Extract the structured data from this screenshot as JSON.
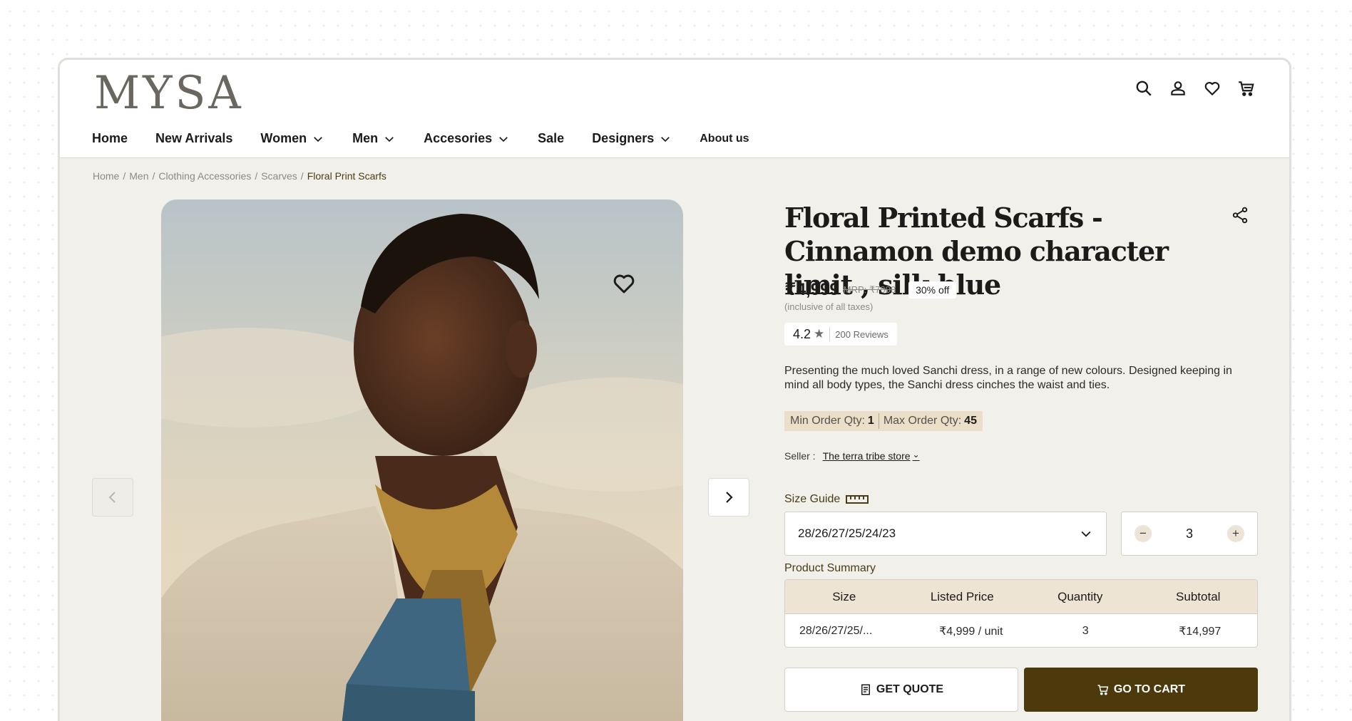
{
  "brand": {
    "logo_text": "MYSA"
  },
  "header_icons": [
    "search-icon",
    "user-icon",
    "heart-icon",
    "cart-icon"
  ],
  "nav": {
    "home": "Home",
    "new_arrivals": "New Arrivals",
    "women": "Women",
    "men": "Men",
    "accesories": "Accesories",
    "sale": "Sale",
    "designers": "Designers",
    "about": "About us"
  },
  "breadcrumb": {
    "home": "Home",
    "men": "Men",
    "clothing": "Clothing Accessories",
    "scarves": "Scarves",
    "current": "Floral Print Scarfs",
    "separator": "/"
  },
  "product": {
    "title": "Floral Printed Scarfs - Cinnamon demo character limit , silk blue",
    "price": "₹4,999",
    "mrp": "MRP: ₹7000",
    "discount": "30% off",
    "tax_note": "(inclusive of all taxes)",
    "rating": "4.2",
    "rating_star": "★",
    "reviews": "200 Reviews",
    "description": "Presenting the much loved Sanchi dress, in a range of new colours. Designed keeping in mind all body types, the Sanchi dress cinches the waist and ties.",
    "min_qty_label": "Min Order Qty:",
    "min_qty": "1",
    "max_qty_label": "Max Order Qty:",
    "max_qty": "45",
    "seller_label": "Seller :",
    "seller_name": "The terra tribe store"
  },
  "size": {
    "guide_label": "Size Guide",
    "selected": "28/26/27/25/24/23"
  },
  "quantity": {
    "value": "3",
    "minus": "−",
    "plus": "+"
  },
  "summary": {
    "label": "Product Summary",
    "headers": [
      "Size",
      "Listed Price",
      "Quantity",
      "Subtotal"
    ],
    "rows": [
      [
        "28/26/27/25/...",
        "₹4,999 / unit",
        "3",
        "₹14,997"
      ]
    ]
  },
  "actions": {
    "quote": "GET QUOTE",
    "cart": "GO TO CART"
  },
  "colors": {
    "accent_dark": "#4c3a0d",
    "page_bg": "#f1f0eb",
    "qty_limits_bg": "#ecdfc9",
    "table_header_bg": "#ede4d4"
  }
}
